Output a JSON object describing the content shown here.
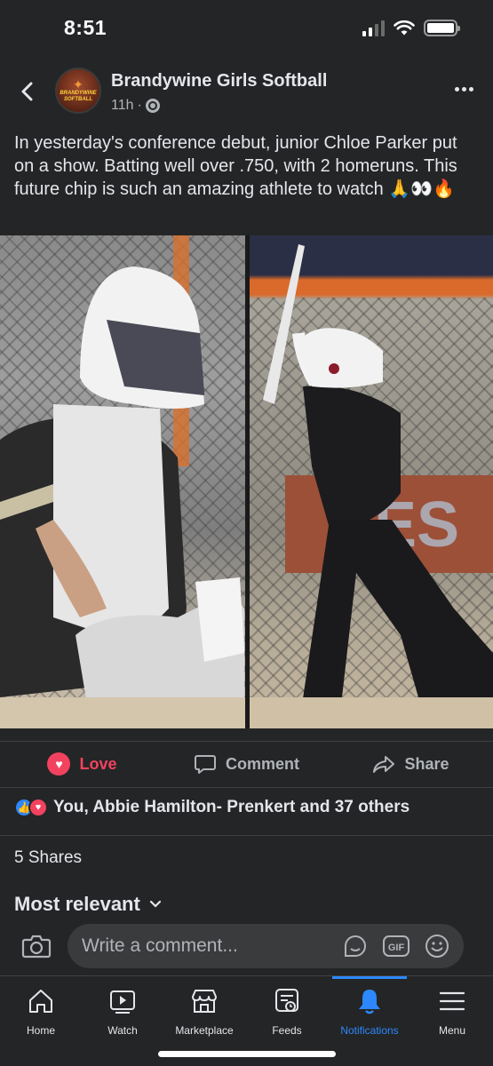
{
  "status_bar": {
    "time": "8:51"
  },
  "post": {
    "page_name": "Brandywine Girls Softball",
    "avatar_text": "BRANDYWINE SOFTBALL",
    "time_ago": "11h",
    "separator": "·",
    "caption": "In yesterday's conference debut, junior Chloe Parker put on a show. Batting well over .750, with 2 homeruns. This future chip is such an amazing athlete to watch 🙏👀🔥"
  },
  "actions": {
    "love_label": "Love",
    "comment_label": "Comment",
    "share_label": "Share"
  },
  "reactions": {
    "summary": "You, Abbie Hamilton- Prenkert and 37 others"
  },
  "shares_text": "5 Shares",
  "sort_label": "Most relevant",
  "comment_box": {
    "placeholder": "Write a comment..."
  },
  "tabs": [
    {
      "label": "Home",
      "icon": "home-icon"
    },
    {
      "label": "Watch",
      "icon": "watch-icon"
    },
    {
      "label": "Marketplace",
      "icon": "marketplace-icon"
    },
    {
      "label": "Feeds",
      "icon": "feeds-icon"
    },
    {
      "label": "Notifications",
      "icon": "notifications-icon",
      "active": true
    },
    {
      "label": "Menu",
      "icon": "menu-icon"
    }
  ],
  "colors": {
    "background": "#242526",
    "accent": "#2d88ff",
    "love": "#f3425f"
  }
}
